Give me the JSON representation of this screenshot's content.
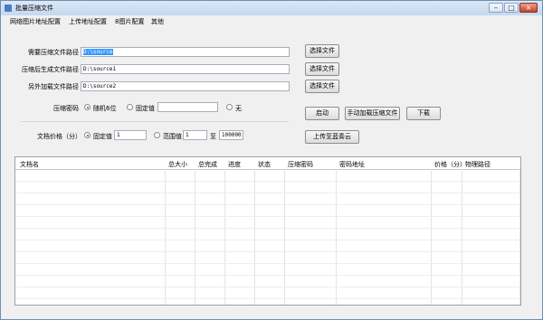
{
  "window": {
    "title": "批量压缩文件",
    "controls": {
      "minimize": "–",
      "maximize": "□",
      "close": "×"
    }
  },
  "menu": [
    "网络图片地址配置",
    "上传地址配置",
    "8图片配置",
    "其他"
  ],
  "form": {
    "source_label": "需要压缩文件路径",
    "source_value": "D:\\source",
    "output_label": "压缩后生成文件路径",
    "output_value": "D:\\source1",
    "extra_label": "另外加载文件路径",
    "extra_value": "D:\\source2",
    "choose_file": "选择文件",
    "password_label": "压缩密码",
    "pw_random": "随机6位",
    "pw_fixed": "固定值",
    "pw_fixed_value": "",
    "pw_none": "无",
    "pw_selected": "随机6位",
    "price_label": "文档价格（分）",
    "price_fixed": "固定值",
    "price_fixed_value": "1",
    "price_range": "范围值",
    "price_min": "1",
    "price_to": "至",
    "price_max": "100000",
    "price_selected": "固定值"
  },
  "actions": {
    "start": "启动",
    "manual_load": "手动加载压缩文件",
    "download": "下载",
    "upload_cloud": "上传至蓝奏云"
  },
  "table": {
    "columns": [
      "文档名",
      "总大小",
      "总完成",
      "进度",
      "状态",
      "压缩密码",
      "密码地址",
      "价格（分）",
      "物理路径"
    ],
    "rows": []
  }
}
